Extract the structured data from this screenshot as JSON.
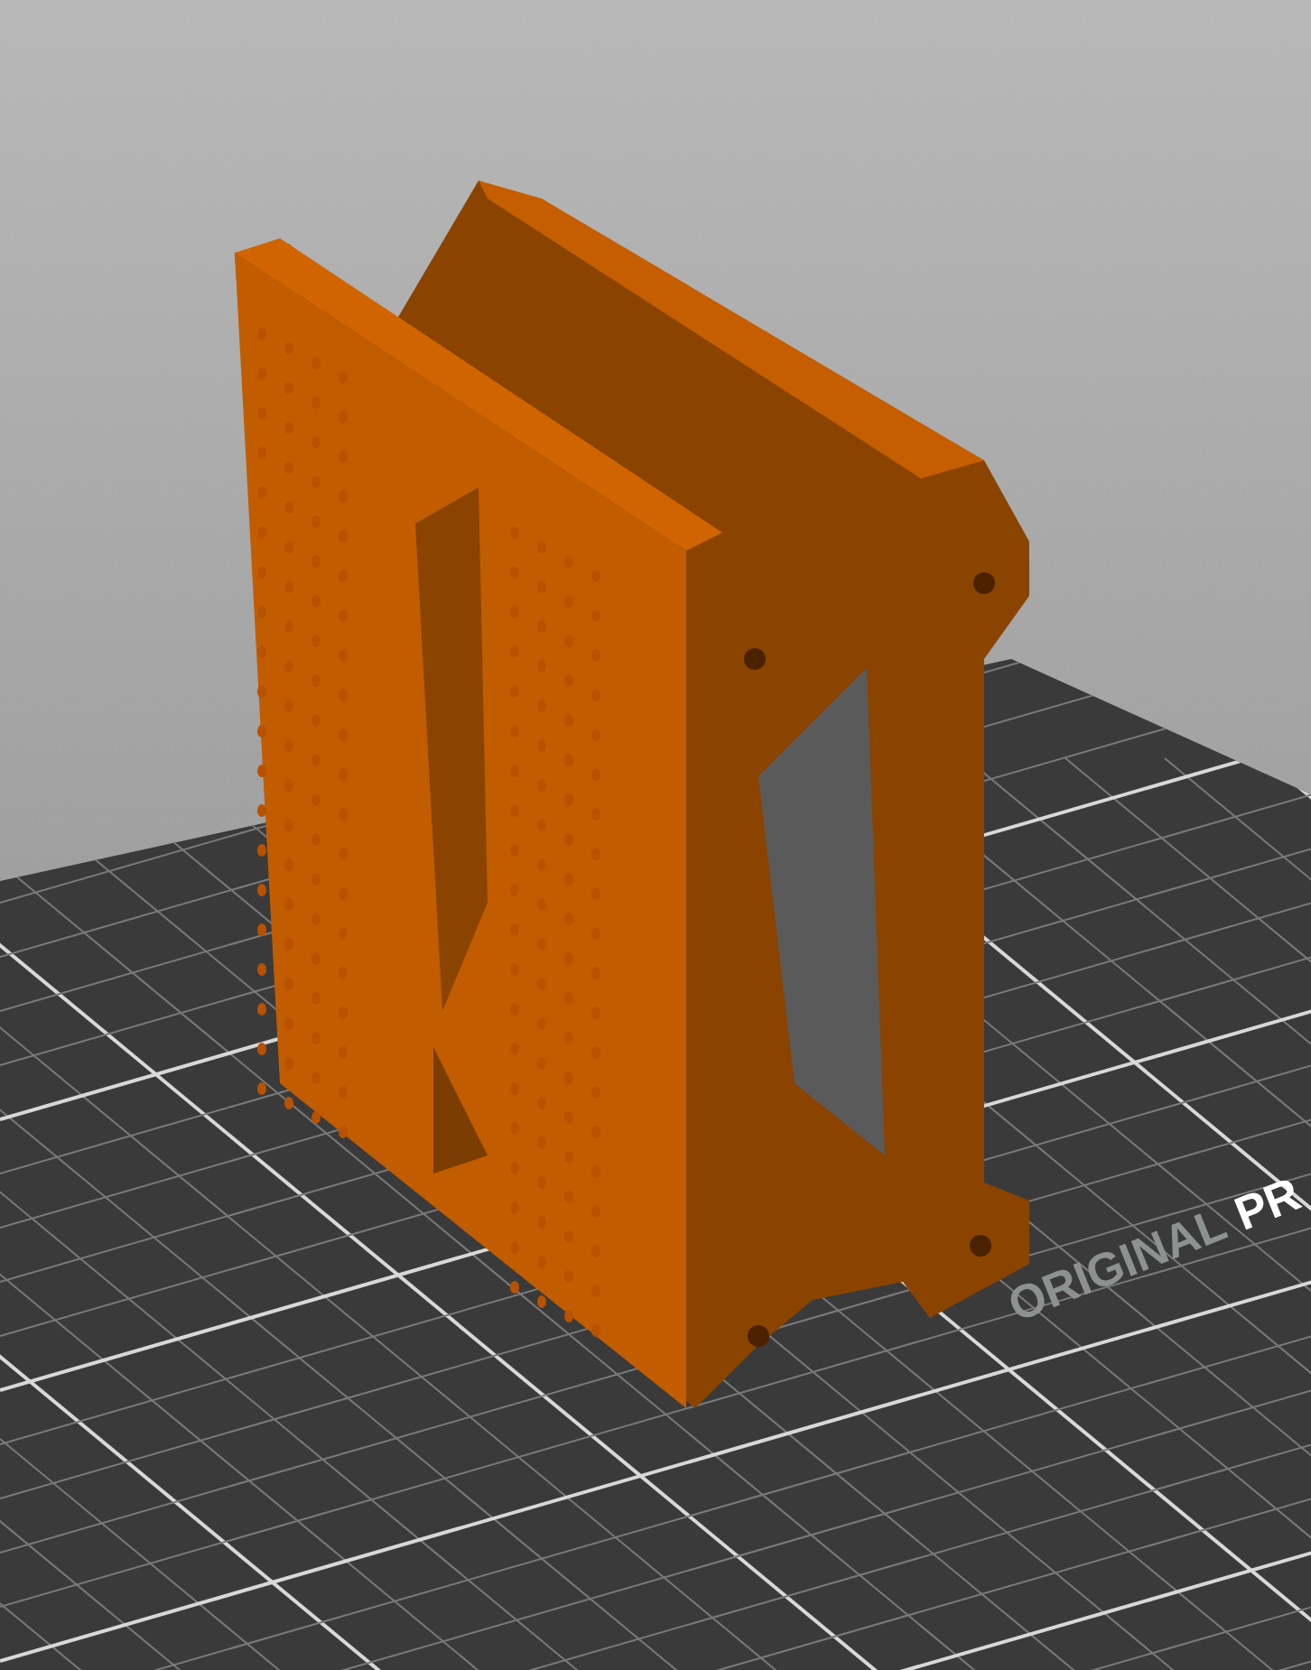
{
  "viewport": {
    "bed_label": [
      {
        "text": "ORIGINAL",
        "emphasis": false
      },
      {
        "text": "PR",
        "emphasis": true
      }
    ]
  }
}
